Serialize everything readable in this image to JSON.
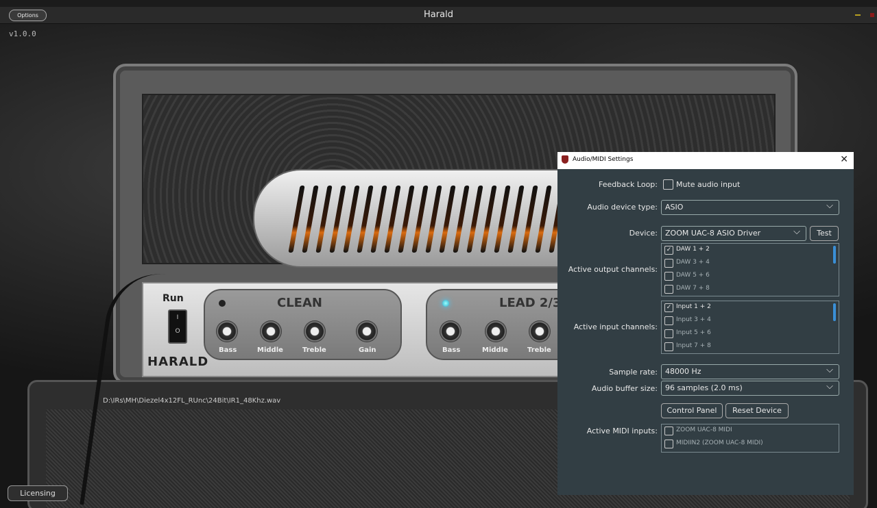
{
  "window": {
    "title": "Harald",
    "options_label": "Options",
    "version": "v1.0.0",
    "licensing_label": "Licensing",
    "ir_path": "D:\\IRs\\MH\\Diezel4x12FL_RUnc\\24Bit\\IR1_48Khz.wav"
  },
  "amp": {
    "brand": "HARALD",
    "run_label": "Run",
    "switch_on": "I",
    "switch_off": "O",
    "clean": {
      "title": "CLEAN",
      "knobs": [
        "Bass",
        "Middle",
        "Treble",
        "Gain"
      ]
    },
    "lead": {
      "title": "LEAD 2/3",
      "knobs": [
        "Bass",
        "Middle",
        "Treble"
      ]
    }
  },
  "dialog": {
    "title": "Audio/MIDI Settings",
    "feedback_label": "Feedback Loop:",
    "mute_label": "Mute audio input",
    "device_type_label": "Audio device type:",
    "device_type_value": "ASIO",
    "device_label": "Device:",
    "device_value": "ZOOM UAC-8 ASIO Driver",
    "test_label": "Test",
    "output_label": "Active output channels:",
    "outputs": [
      "DAW 1 + 2",
      "DAW 3 + 4",
      "DAW 5 + 6",
      "DAW 7 + 8"
    ],
    "input_label": "Active input channels:",
    "inputs": [
      "Input 1 + 2",
      "Input 3 + 4",
      "Input 5 + 6",
      "Input 7 + 8"
    ],
    "sample_rate_label": "Sample rate:",
    "sample_rate_value": "48000 Hz",
    "buffer_label": "Audio buffer size:",
    "buffer_value": "96 samples (2.0 ms)",
    "control_panel_label": "Control Panel",
    "reset_label": "Reset Device",
    "midi_label": "Active MIDI inputs:",
    "midi_inputs": [
      "ZOOM UAC-8 MIDI",
      "MIDIIN2 (ZOOM UAC-8 MIDI)"
    ],
    "checked_mark": "✓"
  }
}
